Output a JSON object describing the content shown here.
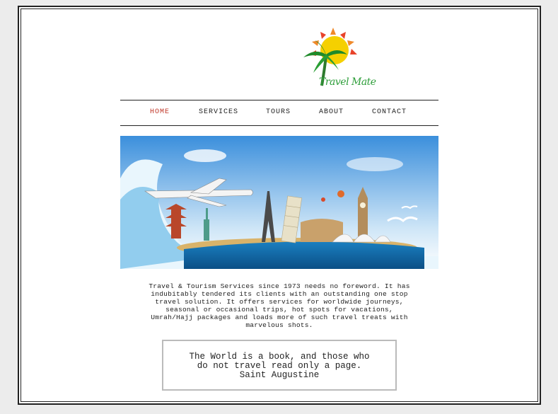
{
  "logo": {
    "text": "Travel Mate"
  },
  "nav": {
    "items": [
      {
        "label": "HOME",
        "active": true
      },
      {
        "label": "SERVICES",
        "active": false
      },
      {
        "label": "TOURS",
        "active": false
      },
      {
        "label": "ABOUT",
        "active": false
      },
      {
        "label": "CONTACT",
        "active": false
      }
    ]
  },
  "description": {
    "lines": [
      "Travel & Tourism Services since 1973 needs no foreword. It has",
      "indubitably tendered its clients with an outstanding one stop",
      "travel solution. It offers services for worldwide journeys,",
      "seasonal or occasional trips, hot spots for vacations,",
      "Umrah/Hajj packages and loads more of such travel treats with",
      "marvelous shots."
    ]
  },
  "quote": {
    "line1": "The World is a book, and those who",
    "line2": "do not travel read only a page.",
    "author": "Saint Augustine"
  },
  "colors": {
    "active_nav": "#c0392b",
    "brand_green": "#2e9e3a",
    "sun": "#f5d000",
    "sky": "#5aa9e6",
    "sea": "#1a7fc0"
  }
}
